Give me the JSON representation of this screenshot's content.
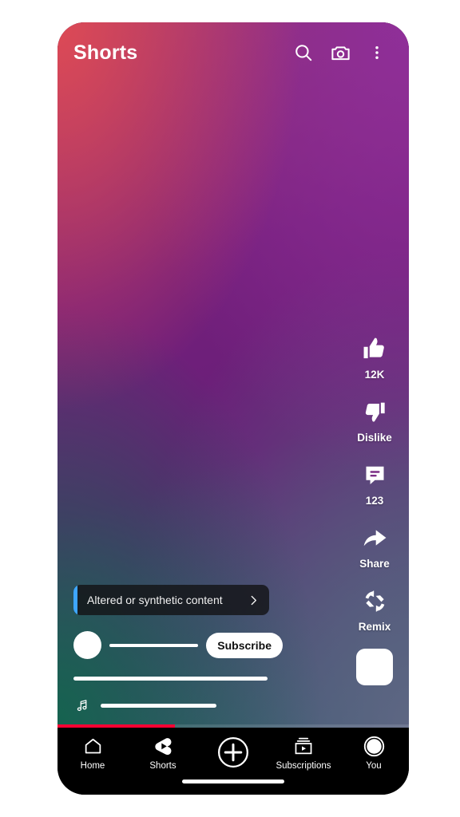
{
  "header": {
    "title": "Shorts",
    "icons": [
      {
        "name": "search-icon",
        "label": "Search"
      },
      {
        "name": "camera-icon",
        "label": "Camera"
      },
      {
        "name": "more-vertical-icon",
        "label": "More options"
      }
    ]
  },
  "action_rail": [
    {
      "icon": "thumbs-up-icon",
      "label": "12K"
    },
    {
      "icon": "thumbs-down-icon",
      "label": "Dislike"
    },
    {
      "icon": "comment-icon",
      "label": "123"
    },
    {
      "icon": "share-icon",
      "label": "Share"
    },
    {
      "icon": "remix-icon",
      "label": "Remix"
    }
  ],
  "overlay": {
    "synthetic_chip": {
      "label": "Altered or synthetic content",
      "chevron": "chevron-right-icon",
      "accent_color": "#3ea6ff"
    },
    "subscribe_label": "Subscribe",
    "music_icon": "music-note-icon"
  },
  "player": {
    "progress_percent": 33.5,
    "progress_color": "#ff0033"
  },
  "bottom_nav": [
    {
      "icon": "home-icon",
      "label": "Home",
      "active": false
    },
    {
      "icon": "shorts-icon",
      "label": "Shorts",
      "active": true
    },
    {
      "icon": "create-plus-icon",
      "label": "",
      "active": false
    },
    {
      "icon": "subscriptions-icon",
      "label": "Subscriptions",
      "active": false
    },
    {
      "icon": "account-avatar-icon",
      "label": "You",
      "active": false
    }
  ],
  "colors": {
    "gradient_top_left": "#dd4a55",
    "gradient_top_right": "#8f2f99",
    "gradient_bottom_left": "#15634f",
    "gradient_bottom_right": "#5e6683",
    "accent_blue": "#3ea6ff",
    "progress_red": "#ff0033",
    "nav_background": "#000000"
  }
}
